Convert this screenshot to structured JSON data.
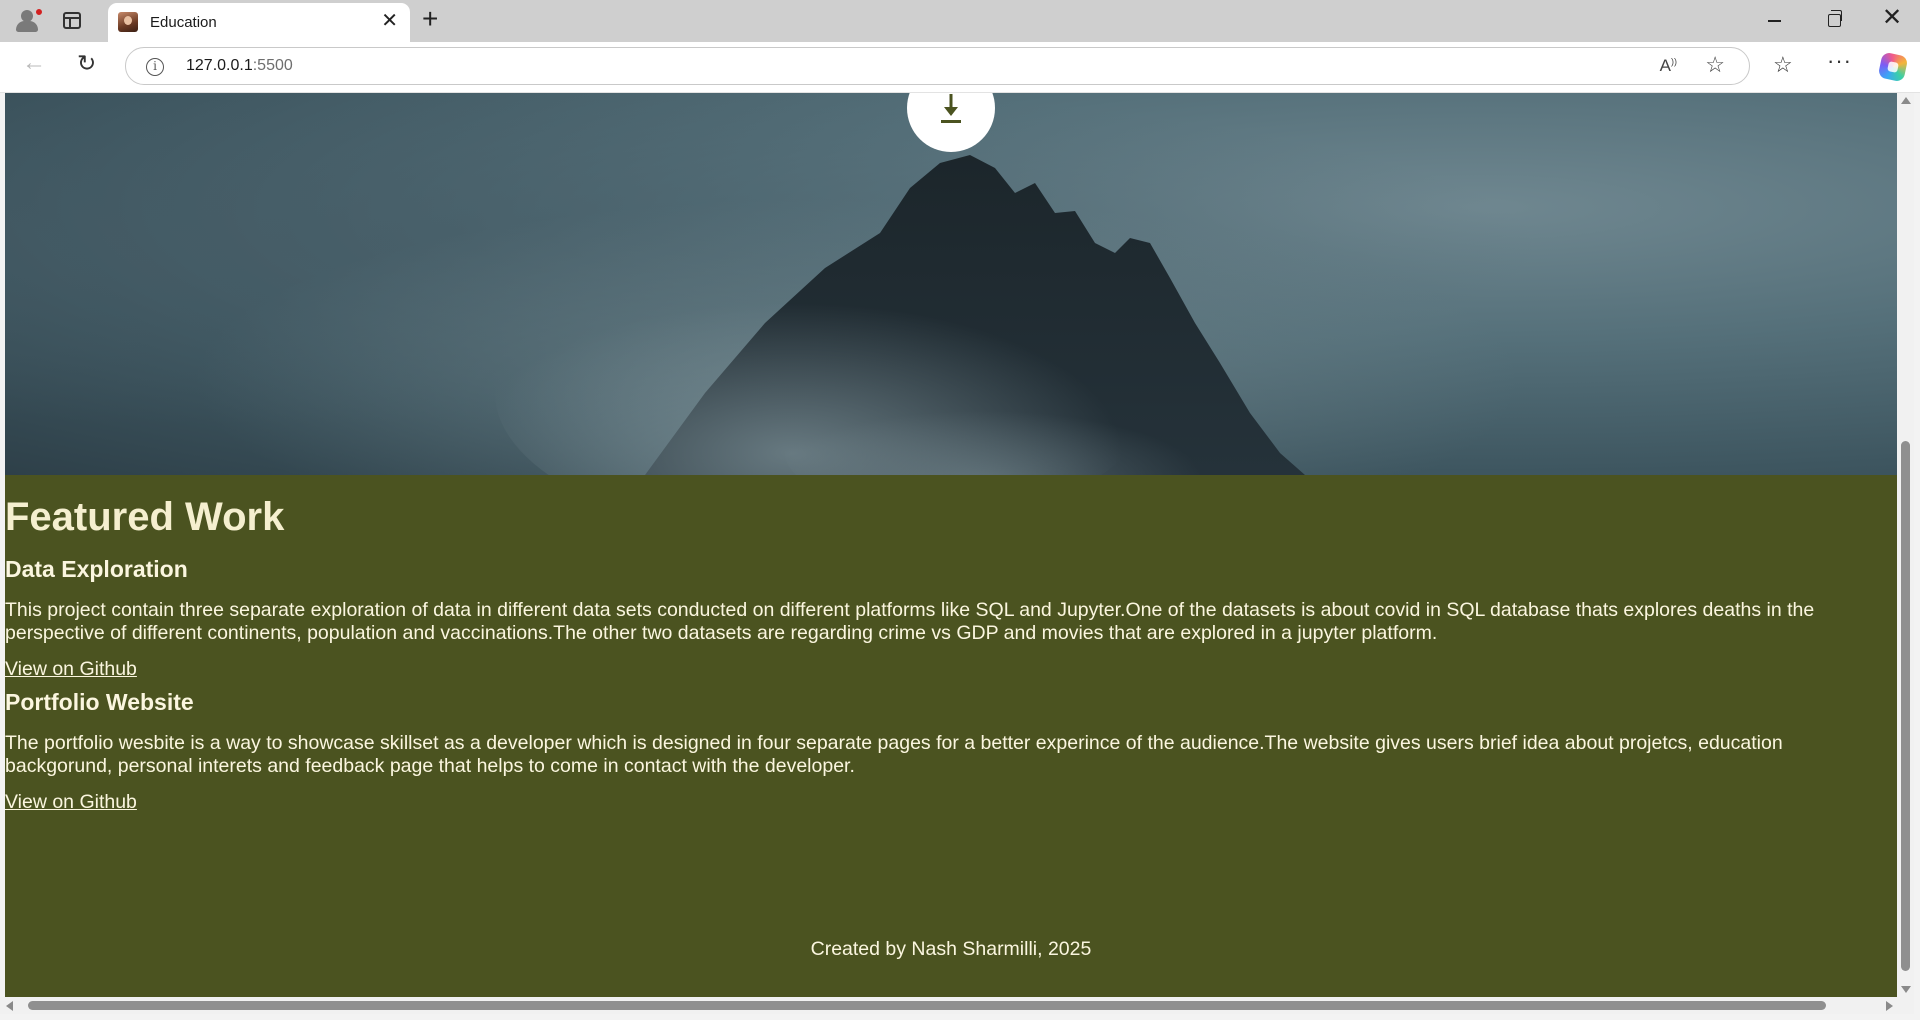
{
  "browser": {
    "tab_title": "Education",
    "url_host": "127.0.0.1",
    "url_port": ":5500",
    "new_tab_icon": "plus-icon",
    "close_tab_icon": "close-icon"
  },
  "hero": {
    "download_icon": "download-icon"
  },
  "featured": {
    "title": "Featured Work",
    "projects": [
      {
        "title": "Data Exploration",
        "description": "This project contain three separate exploration of data in different data sets conducted on different platforms like SQL and Jupyter.One of the datasets is about covid in SQL database thats explores deaths in the perspective of different continents, population and vaccinations.The other two datasets are regarding crime vs GDP and movies that are explored in a jupyter platform.",
        "link": "View on Github"
      },
      {
        "title": "Portfolio Website",
        "description": "The portfolio wesbite is a way to showcase skillset as a developer which is designed in four separate pages for a better experince of the audience.The website gives users brief idea about projetcs, education backgorund, personal interets and feedback page that helps to come in contact with the developer.",
        "link": "View on Github"
      }
    ]
  },
  "footer": {
    "text": "Created by Nash Sharmilli, 2025"
  },
  "colors": {
    "content_bg": "#4b5320",
    "heading_text": "#f5efcf",
    "body_text": "#fbf6df"
  }
}
